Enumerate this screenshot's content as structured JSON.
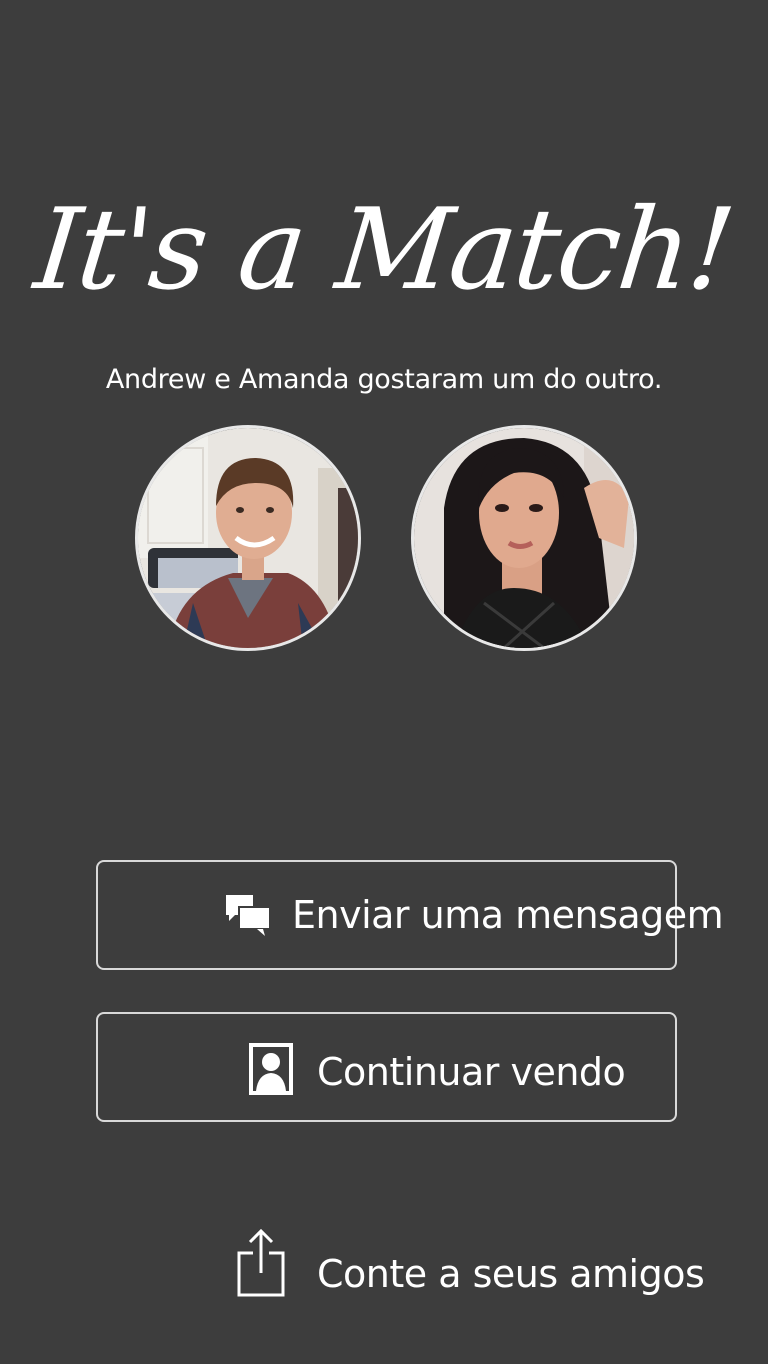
{
  "match": {
    "title": "It's a Match!",
    "subtitle": "Andrew e Amanda gostaram um do outro."
  },
  "profiles": [
    {
      "name": "Andrew",
      "avatar": "man-portrait-photo"
    },
    {
      "name": "Amanda",
      "avatar": "woman-portrait-photo"
    }
  ],
  "actions": {
    "send_message": {
      "label": "Enviar uma mensagem",
      "icon": "chat-bubbles-icon"
    },
    "keep_swiping": {
      "label": "Continuar vendo",
      "icon": "person-card-icon"
    },
    "share": {
      "label": "Conte a seus amigos",
      "icon": "share-icon"
    }
  },
  "colors": {
    "background": "#3d3d3d",
    "text": "#ffffff",
    "border": "#d9d9d9"
  }
}
